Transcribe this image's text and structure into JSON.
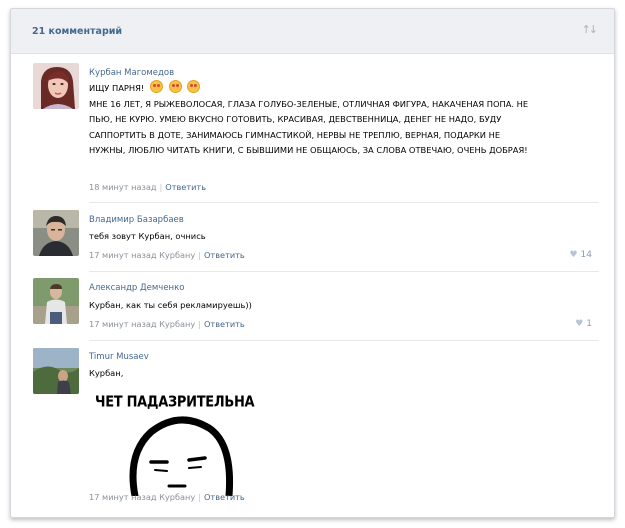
{
  "header": {
    "title": "21 комментарий",
    "sort_icon": "sort-arrows-icon"
  },
  "comments": [
    {
      "author": "Курбан Магомедов",
      "first_line": "ИЩУ ПАРНЯ!",
      "body": "МНЕ 16 ЛЕТ, Я РЫЖЕВОЛОСАЯ, ГЛАЗА ГОЛУБО-ЗЕЛЕНЫЕ, ОТЛИЧНАЯ ФИГУРА, НАКАЧЕНАЯ ПОПА. НЕ ПЬЮ, НЕ КУРЮ. УМЕЮ ВКУСНО ГОТОВИТЬ, КРАСИВАЯ, ДЕВСТВЕННИЦА, ДЕНЕГ НЕ НАДО, БУДУ САППОРТИТЬ В ДОТЕ, ЗАНИМАЮСЬ ГИМНАСТИКОЙ, НЕРВЫ НЕ ТРЕПЛЮ, ВЕРНАЯ, ПОДАРКИ НЕ НУЖНЫ, ЛЮБЛЮ ЧИТАТЬ КНИГИ, С БЫВШИМИ НЕ ОБЩАЮСЬ, ЗА СЛОВА ОТВЕЧАЮ, ОЧЕНЬ ДОБРАЯ!",
      "time": "18 минут назад",
      "reply": "Ответить"
    },
    {
      "author": "Владимир Базарбаев",
      "body": "тебя зовут Курбан, очнись",
      "time": "17 минут назад Курбану",
      "reply": "Ответить",
      "likes": "14"
    },
    {
      "author": "Александр Демченко",
      "body": "Курбан, как ты себя рекламируешь))",
      "time": "17 минут назад Курбану",
      "reply": "Ответить",
      "likes": "1"
    },
    {
      "author": "Timur Musaev",
      "body": "Курбан,",
      "meme_caption": "ЧЕТ ПАДАЗРИТЕЛЬНА",
      "time": "17 минут назад Курбану",
      "reply": "Ответить"
    }
  ],
  "colors": {
    "link": "#45688e",
    "meta": "#8a9099",
    "header_bg": "#eef0f3"
  }
}
